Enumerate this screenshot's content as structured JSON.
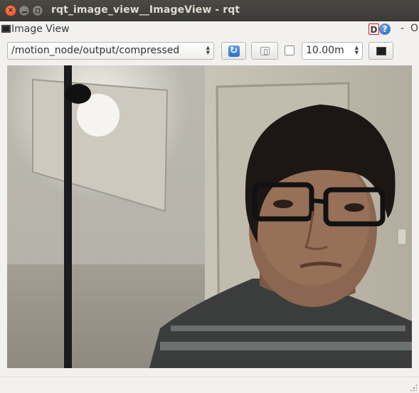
{
  "window": {
    "title": "rqt_image_view__ImageView - rqt",
    "close_glyph": "×",
    "minimize_glyph": "",
    "maximize_glyph": ""
  },
  "dock": {
    "title": "Image View",
    "d_label": "D",
    "help_label": "?",
    "minimize_label": "-",
    "close_label": "O"
  },
  "toolbar": {
    "topic": "/motion_node/output/compressed",
    "refresh_glyph": "↻",
    "zoom_checked": false,
    "duration": "10.00m"
  },
  "icons": {
    "close": "close-icon",
    "minimize": "minimize-icon",
    "maximize": "maximize-icon",
    "dock": "window-icon",
    "help": "help-icon",
    "refresh": "refresh-icon",
    "zoom": "zoom-fit-icon",
    "save": "save-image-icon"
  }
}
